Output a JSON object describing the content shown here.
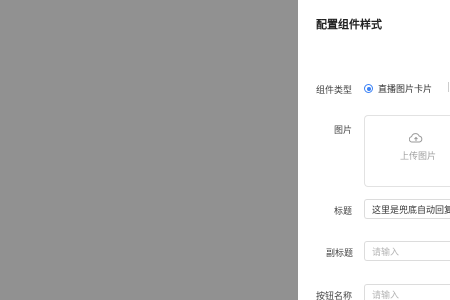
{
  "panel": {
    "title": "配置组件样式",
    "component_type": {
      "label": "组件类型",
      "selected_option": "直播图片卡片"
    },
    "image": {
      "label": "图片",
      "upload_text": "上传图片",
      "icon": "cloud-upload-icon"
    },
    "title_field": {
      "label": "标题",
      "value": "这里是兜底自动回复"
    },
    "subtitle_field": {
      "label": "副标题",
      "placeholder": "请输入"
    },
    "button_name_field": {
      "label": "按钮名称",
      "placeholder": "请输入"
    },
    "colors": {
      "overlay": "#919191",
      "accent": "#3b82f6"
    }
  }
}
